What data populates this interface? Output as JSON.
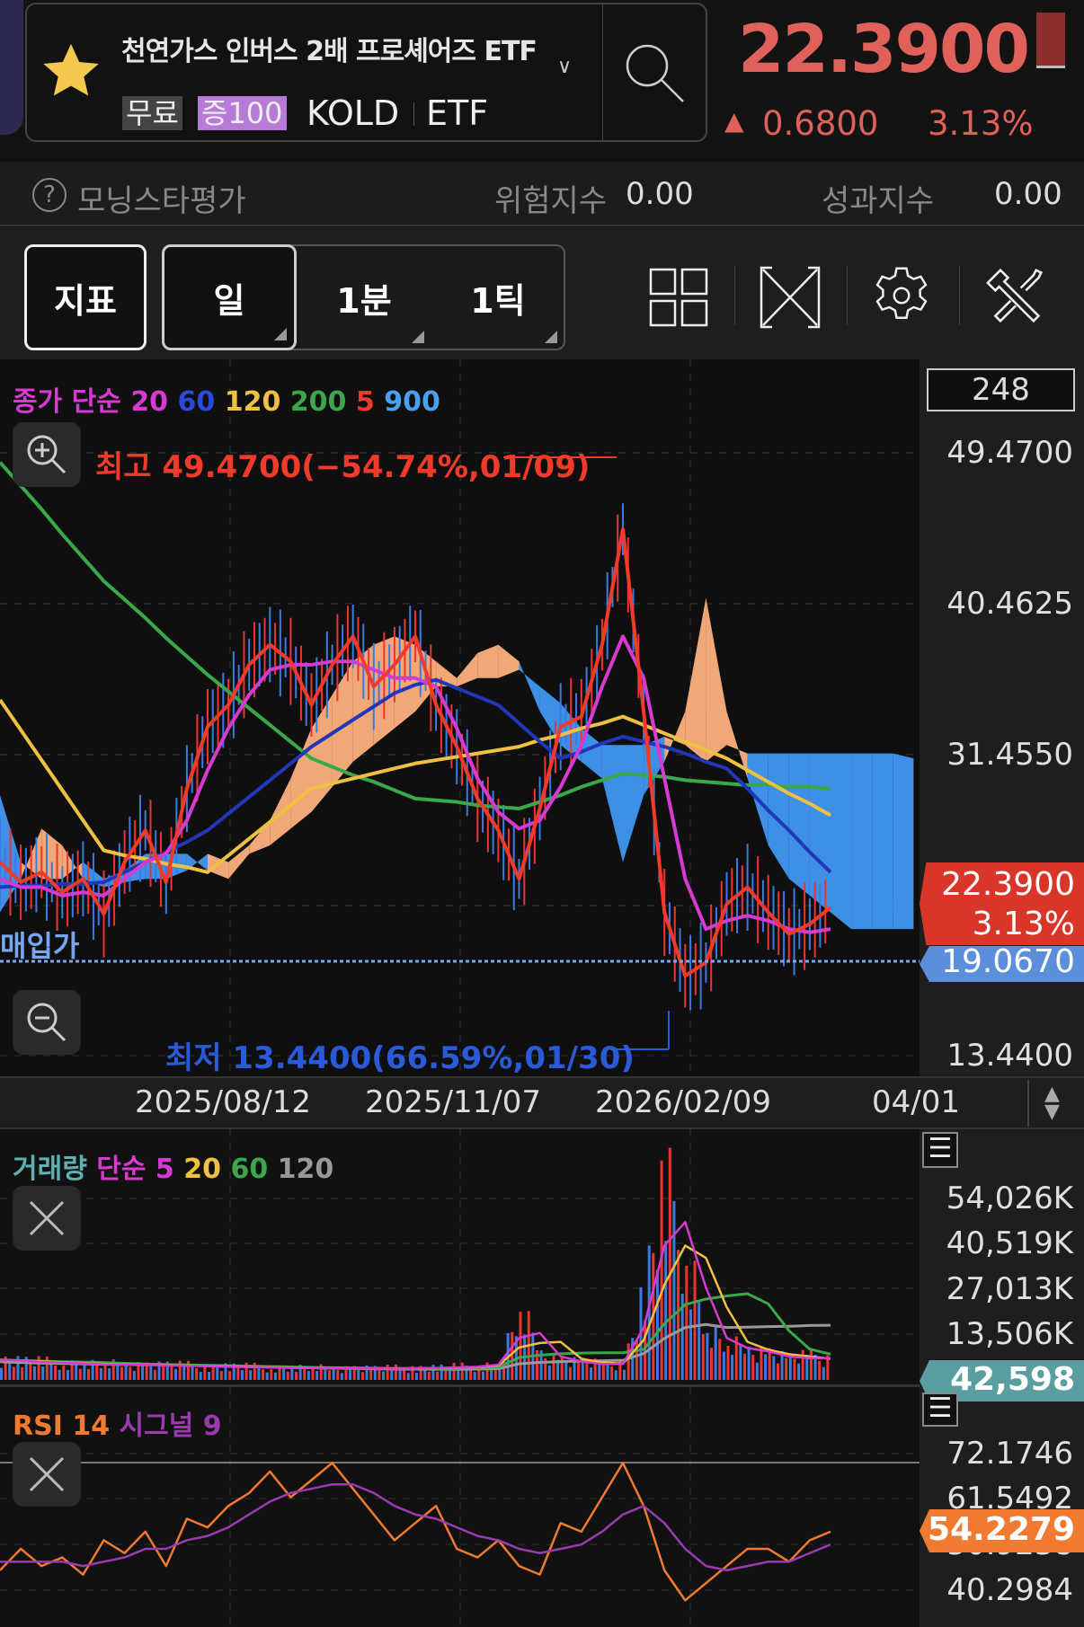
{
  "header": {
    "title": "천연가스 인버스 2배 프로셰어즈 ETF",
    "badge_free": "무료",
    "badge_margin": "증100",
    "ticker": "KOLD",
    "type": "ETF",
    "price": "22.3900",
    "change": "0.6800",
    "change_pct": "3.13%",
    "up_arrow": "▲"
  },
  "rating": {
    "label": "모닝스타평가",
    "risk_label": "위험지수",
    "risk_value": "0.00",
    "perf_label": "성과지수",
    "perf_value": "0.00"
  },
  "toolbar": {
    "indicator": "지표",
    "day": "일",
    "min": "1분",
    "tick": "1틱"
  },
  "chart": {
    "legend": {
      "prefix": "종가 단순",
      "p20": "20",
      "p60": "60",
      "p120": "120",
      "p200": "200",
      "p5": "5",
      "p900": "900"
    },
    "count": "248",
    "high_label": "최고 49.4700(−54.74%,01/09)",
    "low_label": "최저 13.4400(66.59%,01/30)",
    "buy_label": "매입가",
    "y_ticks": [
      "49.4700",
      "40.4625",
      "31.4550",
      "13.4400"
    ],
    "current_price": "22.3900",
    "current_pct": "3.13%",
    "buy_price": "19.0670",
    "dates": [
      "2025/08/12",
      "2025/11/07",
      "2026/02/09",
      "04/01"
    ],
    "colors": {
      "ma5": "#f03a2a",
      "ma20": "#d63ad0",
      "ma60": "#2236b8",
      "ma120": "#f0c040",
      "ma200": "#3aa84a",
      "ma900": "#4aa0f0",
      "up": "#e33",
      "down": "#3a7be0"
    }
  },
  "chart_data": {
    "type": "line",
    "price_range": [
      13.44,
      49.47
    ],
    "ma5": [
      25.0,
      23.8,
      24.4,
      23.2,
      24.0,
      21.9,
      25.0,
      26.9,
      23.8,
      29.4,
      33.1,
      34.4,
      36.8,
      38.0,
      37.0,
      34.4,
      36.8,
      38.5,
      35.5,
      36.8,
      38.5,
      34.4,
      31.9,
      28.8,
      26.9,
      24.0,
      28.2,
      33.1,
      33.7,
      38.0,
      44.9,
      34.0,
      22.0,
      18.2,
      19.0,
      22.5,
      23.5,
      22.0,
      20.7,
      21.3,
      22.3
    ],
    "ma20": [
      24.0,
      23.5,
      23.5,
      23.0,
      23.2,
      23.0,
      24.0,
      25.0,
      25.5,
      27.5,
      30.5,
      33.0,
      35.0,
      36.5,
      36.8,
      36.8,
      37.0,
      37.0,
      36.5,
      36.0,
      36.0,
      35.5,
      33.0,
      30.0,
      28.0,
      27.0,
      27.5,
      29.5,
      32.0,
      35.5,
      38.5,
      36.0,
      30.0,
      24.0,
      21.0,
      21.5,
      21.8,
      21.5,
      21.0,
      20.8,
      21.0
    ],
    "ma60": [
      23.5,
      23.6,
      23.6,
      23.7,
      23.7,
      23.8,
      24.4,
      25.0,
      25.6,
      26.2,
      26.9,
      27.9,
      28.9,
      29.9,
      30.9,
      31.9,
      32.7,
      33.5,
      34.3,
      35.1,
      35.6,
      35.9,
      35.4,
      34.9,
      34.4,
      33.3,
      32.2,
      31.2,
      31.6,
      32.1,
      32.5,
      32.2,
      31.9,
      31.5,
      31.0,
      30.6,
      29.4,
      28.1,
      26.9,
      25.6,
      24.4
    ],
    "ma120": [
      34.7,
      32.9,
      31.1,
      29.3,
      27.5,
      25.7,
      25.4,
      25.2,
      24.9,
      24.7,
      24.4,
      25.4,
      26.4,
      27.4,
      28.4,
      29.4,
      29.7,
      30.0,
      30.3,
      30.6,
      30.9,
      31.1,
      31.3,
      31.5,
      31.7,
      31.9,
      32.3,
      32.6,
      33.0,
      33.3,
      33.7,
      33.2,
      32.7,
      32.2,
      31.7,
      31.2,
      30.5,
      29.8,
      29.1,
      28.5,
      27.8
    ],
    "ma200": [
      48.9,
      47.5,
      46.1,
      44.6,
      43.2,
      41.8,
      40.7,
      39.6,
      38.4,
      37.3,
      36.2,
      35.2,
      34.2,
      33.2,
      32.2,
      31.2,
      30.7,
      30.2,
      29.8,
      29.3,
      28.8,
      28.7,
      28.6,
      28.4,
      28.3,
      28.2,
      28.6,
      29.0,
      29.5,
      29.9,
      30.3,
      30.2,
      30.1,
      29.9,
      29.8,
      29.7,
      29.6,
      29.6,
      29.5,
      29.5,
      29.4
    ],
    "cloud_a": [
      22,
      24,
      27,
      26,
      24,
      23.5,
      23.8,
      24,
      24,
      24.5,
      25.5,
      25,
      26,
      27.5,
      30,
      33,
      35,
      37,
      38,
      38.5,
      38,
      37,
      36,
      37.5,
      38,
      37,
      34,
      32,
      31,
      30,
      25,
      29,
      31,
      34,
      40.8,
      34,
      30,
      26,
      24,
      23,
      22,
      21,
      21,
      21,
      21
    ],
    "cloud_b": [
      29,
      25,
      24,
      24,
      25,
      24,
      24.5,
      25.5,
      25.5,
      25.5,
      24.5,
      24,
      25.5,
      26,
      27,
      28,
      29.5,
      31,
      32,
      33,
      34,
      35.5,
      35.5,
      36,
      36,
      36.5,
      35.5,
      34.5,
      33,
      32,
      32,
      32,
      32.5,
      32,
      31,
      32,
      31.5,
      31.5,
      31.5,
      31.5,
      31.5,
      31.5,
      31.5,
      31.5,
      31.2
    ],
    "volume": {
      "legend_title": "거래량",
      "legend_prefix": "단순",
      "p5": "5",
      "p20": "20",
      "p60": "60",
      "p120": "120",
      "y_ticks": [
        "54,026K",
        "40,519K",
        "27,013K",
        "13,506K"
      ],
      "current": "42,598",
      "values_k": [
        6000,
        5500,
        5200,
        5000,
        4800,
        4500,
        4600,
        4400,
        4300,
        4200,
        4000,
        3900,
        3800,
        3700,
        3600,
        3500,
        3400,
        3500,
        3300,
        3400,
        3500,
        3600,
        3800,
        4000,
        5000,
        20000,
        8000,
        6000,
        5000,
        4500,
        5000,
        26000,
        54000,
        40000,
        15000,
        10000,
        9000,
        8000,
        6000,
        7000,
        6000
      ]
    },
    "rsi": {
      "legend_title": "RSI 14",
      "legend_signal": "시그널 9",
      "y_ticks": [
        "72.1746",
        "61.5492",
        "50.9238",
        "40.2984"
      ],
      "current": "54.2279",
      "values": [
        45,
        50,
        46,
        48,
        44,
        52,
        49,
        54,
        46,
        57,
        55,
        60,
        63,
        68,
        62,
        66,
        70,
        64,
        58,
        52,
        56,
        60,
        50,
        48,
        52,
        46,
        44,
        56,
        54,
        62,
        70,
        60,
        45,
        38,
        42,
        46,
        50,
        50,
        47,
        52,
        54
      ],
      "signal": [
        47,
        47,
        47,
        47,
        46,
        47,
        48,
        50,
        50,
        52,
        53,
        55,
        58,
        61,
        63,
        64,
        65,
        65,
        63,
        60,
        58,
        57,
        55,
        53,
        52,
        50,
        49,
        50,
        51,
        54,
        58,
        60,
        56,
        50,
        46,
        45,
        46,
        47,
        47,
        49,
        51
      ]
    }
  }
}
